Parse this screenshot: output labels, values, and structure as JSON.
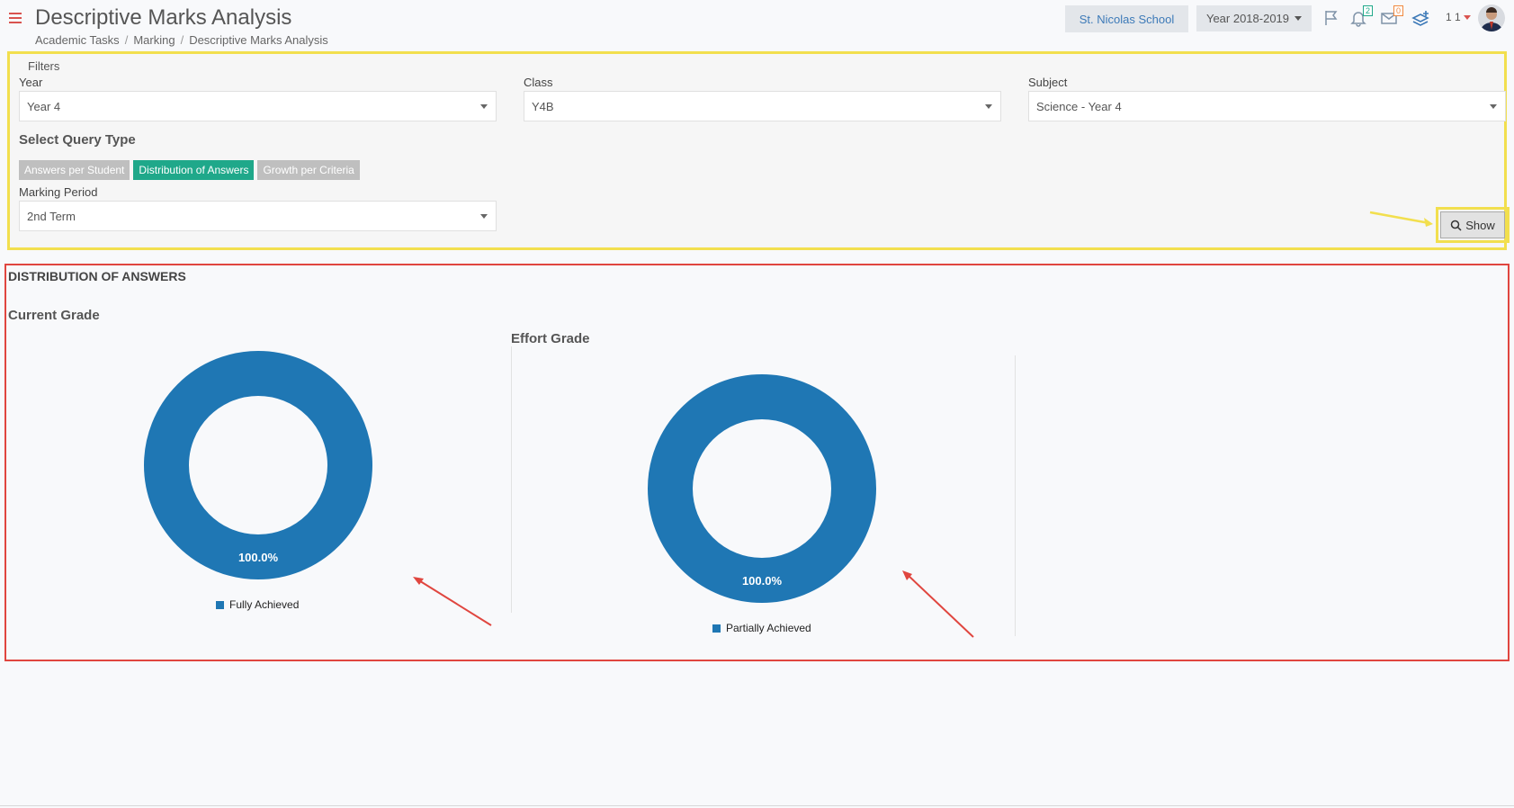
{
  "header": {
    "title": "Descriptive Marks Analysis",
    "breadcrumb": [
      "Academic Tasks",
      "Marking",
      "Descriptive Marks Analysis"
    ],
    "school": "St. Nicolas School",
    "year": "Year 2018-2019",
    "notifications_count": "2",
    "messages_count": "0",
    "user_label": "1 1"
  },
  "filters": {
    "legend": "Filters",
    "year_label": "Year",
    "year_value": "Year 4",
    "class_label": "Class",
    "class_value": "Y4B",
    "subject_label": "Subject",
    "subject_value": "Science - Year 4",
    "query_type_heading": "Select Query Type",
    "query_types": [
      {
        "label": "Answers per Student",
        "active": false
      },
      {
        "label": "Distribution of Answers",
        "active": true
      },
      {
        "label": "Growth per Criteria",
        "active": false
      }
    ],
    "marking_period_label": "Marking Period",
    "marking_period_value": "2nd Term",
    "show_label": "Show"
  },
  "results": {
    "title": "DISTRIBUTION OF ANSWERS"
  },
  "colors": {
    "series": "#1f77b4",
    "active_tab": "#1fa88a",
    "highlight_yellow": "#f2df4e",
    "highlight_red": "#e0463f"
  },
  "chart_data": [
    {
      "type": "pie",
      "title": "Current Grade",
      "categories": [
        "Fully Achieved"
      ],
      "values": [
        100.0
      ],
      "data_labels": [
        "100.0%"
      ],
      "legend": "bottom"
    },
    {
      "type": "pie",
      "title": "Effort Grade",
      "categories": [
        "Partially Achieved"
      ],
      "values": [
        100.0
      ],
      "data_labels": [
        "100.0%"
      ],
      "legend": "bottom"
    }
  ]
}
